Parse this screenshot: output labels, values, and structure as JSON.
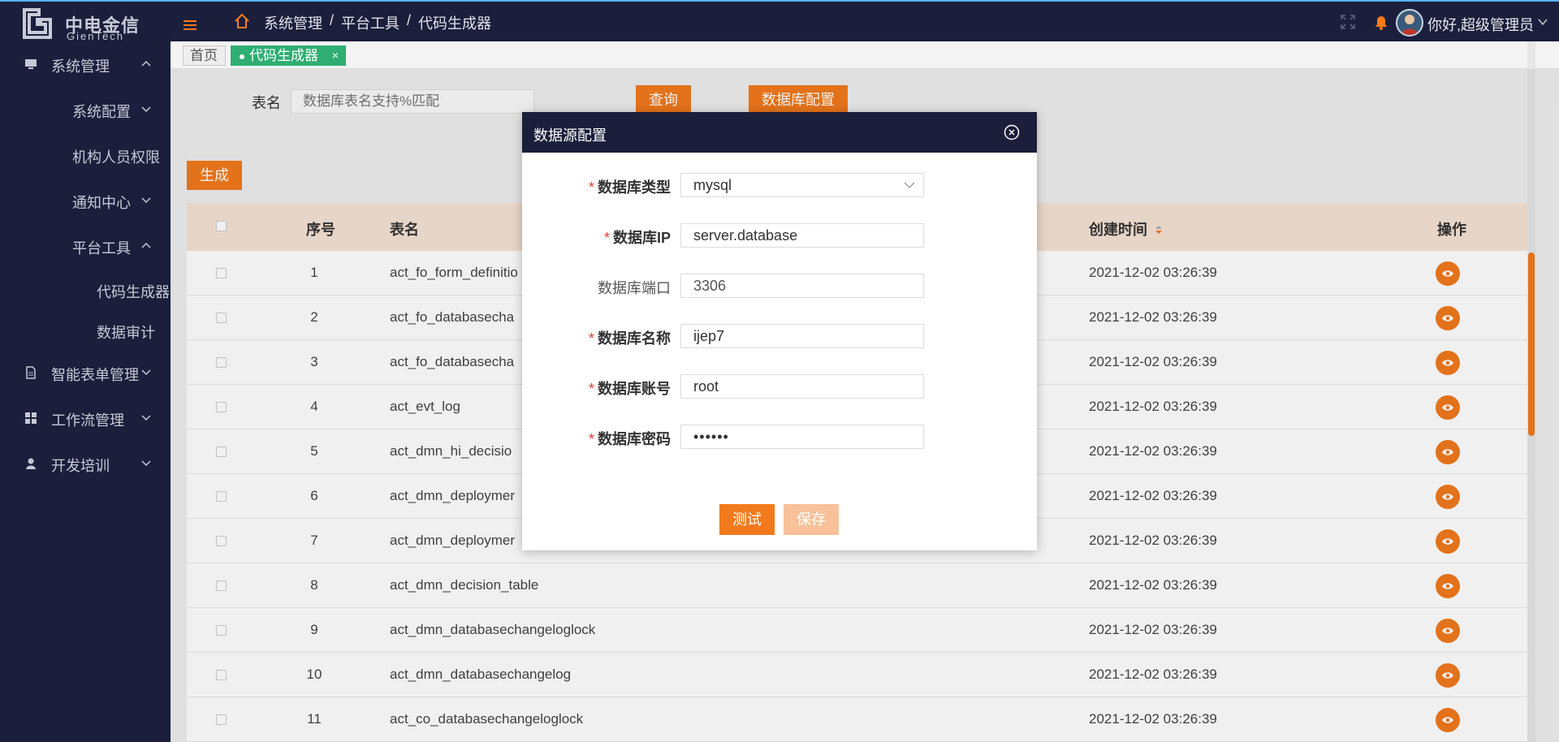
{
  "app": {
    "logo_cn": "中电金信",
    "logo_en": "GienTech",
    "user_greeting": "你好,超级管理员"
  },
  "breadcrumb": [
    "系统管理",
    "平台工具",
    "代码生成器"
  ],
  "sidebar": {
    "items": [
      {
        "label": "系统管理",
        "icon": "monitor-icon",
        "expanded": true
      },
      {
        "label": "系统配置",
        "expanded": false
      },
      {
        "label": "机构人员权限"
      },
      {
        "label": "通知中心",
        "expanded": false
      },
      {
        "label": "平台工具",
        "expanded": true
      },
      {
        "label": "代码生成器"
      },
      {
        "label": "数据审计"
      },
      {
        "label": "智能表单管理",
        "icon": "document-icon",
        "expanded": false
      },
      {
        "label": "工作流管理",
        "icon": "grid-icon",
        "expanded": false
      },
      {
        "label": "开发培训",
        "icon": "user-icon",
        "expanded": false
      }
    ]
  },
  "tabs": {
    "home": "首页",
    "active": "代码生成器",
    "close_glyph": "×"
  },
  "search": {
    "label": "表名",
    "placeholder": "数据库表名支持%匹配",
    "query_button": "查询",
    "dbconfig_button": "数据库配置",
    "generate_button": "生成"
  },
  "table": {
    "headers": {
      "index": "序号",
      "name": "表名",
      "created": "创建时间",
      "action": "操作"
    },
    "rows": [
      {
        "index": "1",
        "name": "act_fo_form_definitio",
        "created": "2021-12-02 03:26:39"
      },
      {
        "index": "2",
        "name": "act_fo_databasecha",
        "created": "2021-12-02 03:26:39"
      },
      {
        "index": "3",
        "name": "act_fo_databasecha",
        "created": "2021-12-02 03:26:39"
      },
      {
        "index": "4",
        "name": "act_evt_log",
        "created": "2021-12-02 03:26:39"
      },
      {
        "index": "5",
        "name": "act_dmn_hi_decisio",
        "created": "2021-12-02 03:26:39"
      },
      {
        "index": "6",
        "name": "act_dmn_deploymer",
        "created": "2021-12-02 03:26:39"
      },
      {
        "index": "7",
        "name": "act_dmn_deploymer",
        "created": "2021-12-02 03:26:39"
      },
      {
        "index": "8",
        "name": "act_dmn_decision_table",
        "created": "2021-12-02 03:26:39"
      },
      {
        "index": "9",
        "name": "act_dmn_databasechangeloglock",
        "created": "2021-12-02 03:26:39"
      },
      {
        "index": "10",
        "name": "act_dmn_databasechangelog",
        "created": "2021-12-02 03:26:39"
      },
      {
        "index": "11",
        "name": "act_co_databasechangeloglock",
        "created": "2021-12-02 03:26:39"
      }
    ]
  },
  "modal": {
    "title": "数据源配置",
    "fields": {
      "db_type": {
        "label": "数据库类型",
        "value": "mysql",
        "required": true
      },
      "db_ip": {
        "label": "数据库IP",
        "value": "server.database",
        "required": true
      },
      "db_port": {
        "label": "数据库端口",
        "value": "3306",
        "required": false
      },
      "db_name": {
        "label": "数据库名称",
        "value": "ijep7",
        "required": true
      },
      "db_user": {
        "label": "数据库账号",
        "value": "root",
        "required": true
      },
      "db_password": {
        "label": "数据库密码",
        "value": "••••••",
        "required": true
      }
    },
    "required_mark": "*",
    "test_button": "测试",
    "save_button": "保存"
  },
  "colors": {
    "nav_bg": "#1b1f3b",
    "accent": "#f27a1c",
    "tab_active": "#2eae72",
    "header_row": "#f6e3d4",
    "save_disabled": "#f8c19a",
    "required": "#e53935"
  }
}
